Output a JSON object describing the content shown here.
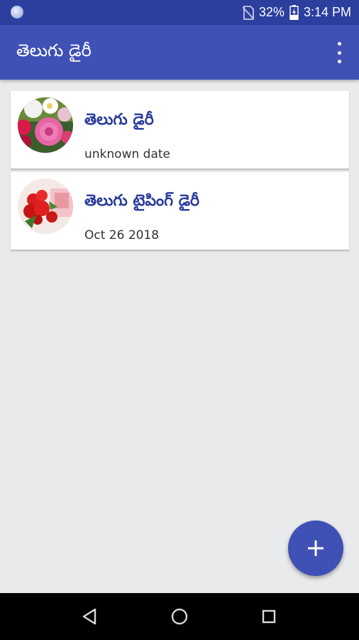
{
  "status_bar": {
    "battery": "32%",
    "time": "3:14 PM"
  },
  "app_bar": {
    "title": "తెలుగు డైరీ",
    "menu_icon": "more-vert-icon"
  },
  "entries": [
    {
      "title": "తెలుగు డైరీ",
      "date": "unknown date",
      "thumbnail": "pink-rose-bouquet"
    },
    {
      "title": "తెలుగు టైపింగ్ డైరీ",
      "date": "Oct 26 2018",
      "thumbnail": "red-rose-bouquet"
    }
  ],
  "fab": {
    "icon": "plus-icon"
  },
  "nav_bar": {
    "icons": [
      "back-icon",
      "home-icon",
      "recents-icon"
    ]
  },
  "colors": {
    "primary": "#3f51b5",
    "primary_dark": "#2c3e9e",
    "title_text": "#2a3c9c",
    "background": "#e9eaec"
  }
}
